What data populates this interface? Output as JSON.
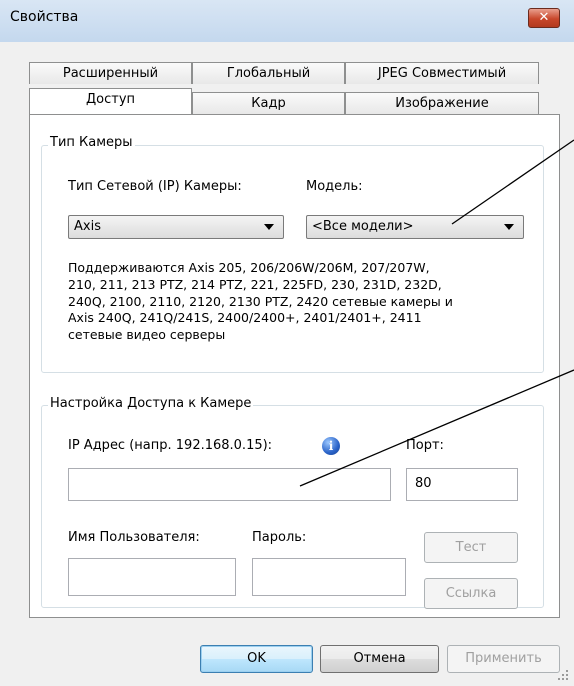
{
  "window": {
    "title": "Свойства",
    "close_label": "✕"
  },
  "tabs_back": [
    "Расширенный",
    "Глобальный",
    "JPEG Совместимый"
  ],
  "tabs_front": [
    "Доступ",
    "Кадр",
    "Изображение"
  ],
  "camera_type": {
    "legend": "Тип Камеры",
    "network_label": "Тип Сетевой (IP) Камеры:",
    "network_value": "Axis",
    "model_label": "Модель:",
    "model_value": "<Все модели>",
    "description_lines": [
      "Поддерживаются Axis 205, 206/206W/206M, 207/207W,",
      "210, 211, 213 PTZ, 214 PTZ, 221, 225FD, 230, 231D, 232D,",
      "240Q, 2100, 2110, 2120, 2130 PTZ, 2420 сетевые камеры и",
      "Axis 240Q, 241Q/241S, 2400/2400+, 2401/2401+, 2411",
      "сетевые видео серверы"
    ]
  },
  "access": {
    "legend": "Настройка Доступа к Камере",
    "ip_label": "IP Адрес (напр. 192.168.0.15):",
    "ip_value": "",
    "port_label": "Порт:",
    "port_value": "80",
    "user_label": "Имя Пользователя:",
    "user_value": "",
    "password_label": "Пароль:",
    "password_value": "",
    "test_button": "Тест",
    "link_button": "Ссылка"
  },
  "footer": {
    "ok": "OK",
    "cancel": "Отмена",
    "apply": "Применить"
  },
  "colors": {
    "accent": "#3c7fb1",
    "close_button": "#c8472b",
    "titlebar": "#c4d8ee"
  }
}
